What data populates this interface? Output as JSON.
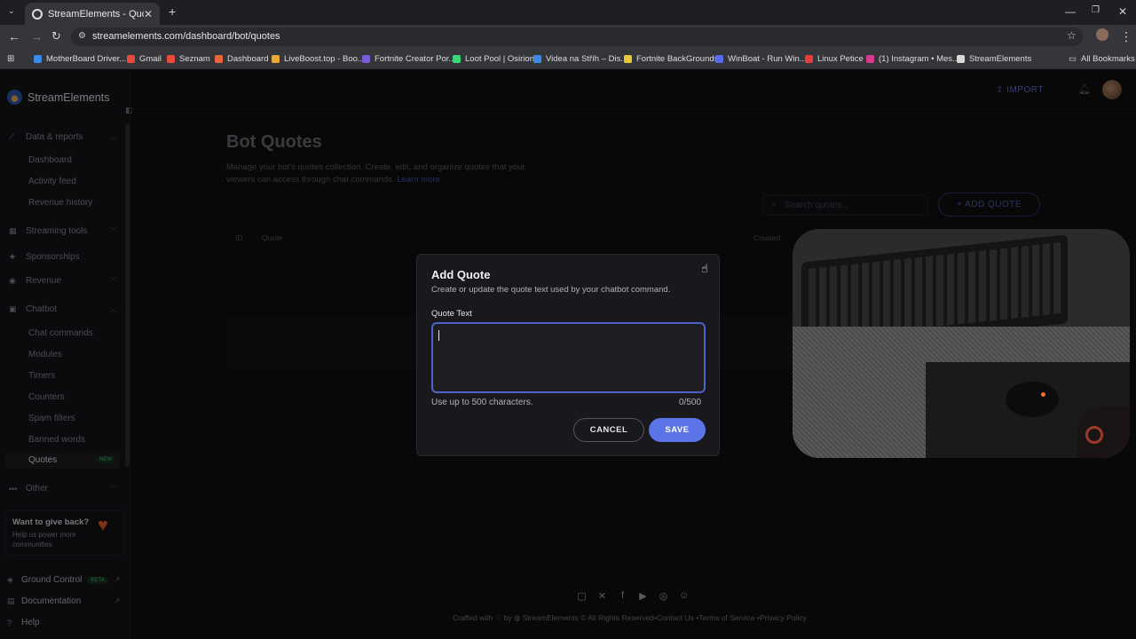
{
  "browser": {
    "tab_title": "StreamElements - Quotes",
    "url": "streamelements.com/dashboard/bot/quotes",
    "new_tab": "+",
    "bookmarks": [
      {
        "label": "MotherBoard Driver...",
        "color": "#3b8be8"
      },
      {
        "label": "Gmail",
        "color": "#e84b3b"
      },
      {
        "label": "Seznam",
        "color": "#e84b3b"
      },
      {
        "label": "Dashboard",
        "color": "#e8653b"
      },
      {
        "label": "LiveBoost.top - Boo...",
        "color": "#e8a83b"
      },
      {
        "label": "Fortnite Creator Por...",
        "color": "#7a5bd8"
      },
      {
        "label": "Loot Pool | Osirion",
        "color": "#3bd87a"
      },
      {
        "label": "Videa na Stříh – Dis...",
        "color": "#3b8be8"
      },
      {
        "label": "Fortnite BackGrounds",
        "color": "#e8c83b"
      },
      {
        "label": "WinBoat - Run Win...",
        "color": "#5b6be8"
      },
      {
        "label": "Linux Petice",
        "color": "#e83b3b"
      },
      {
        "label": "(1) Instagram • Mes...",
        "color": "#d83b8b"
      },
      {
        "label": "StreamElements",
        "color": "#d8d8d8"
      }
    ],
    "all_bookmarks": "All Bookmarks"
  },
  "sidebar": {
    "brand": "StreamElements",
    "sections": {
      "data_reports": "Data & reports",
      "streaming_tools": "Streaming tools",
      "sponsorships": "Sponsorships",
      "revenue": "Revenue",
      "chatbot": "Chatbot",
      "other": "Other"
    },
    "data_items": [
      "Dashboard",
      "Activity feed",
      "Revenue history"
    ],
    "chatbot_items": [
      "Chat commands",
      "Modules",
      "Timers",
      "Counters",
      "Spam filters",
      "Banned words"
    ],
    "active_item": "Quotes",
    "new_badge": "NEW",
    "giveback_title": "Want to give back?",
    "giveback_text": "Help us power more communities",
    "ground_control": "Ground Control",
    "beta_badge": "BETA",
    "documentation": "Documentation",
    "help": "Help"
  },
  "topbar": {
    "import_label": "IMPORT"
  },
  "main": {
    "title": "Bot Quotes",
    "description": "Manage your bot's quotes collection. Create, edit, and organize quotes that your viewers can access through chat commands.",
    "learn_more": "Learn more",
    "search_placeholder": "Search quotes...",
    "add_quote": "ADD QUOTE",
    "columns": {
      "id": "ID",
      "quote": "Quote",
      "created": "Created"
    }
  },
  "footer": {
    "crafted_with": "Crafted with",
    "by": "by",
    "brand": "StreamElements",
    "rights": "© All Rights Reserved",
    "contact": "•Contact Us",
    "terms": "•Terms of Service",
    "privacy": "•Privacy Policy"
  },
  "modal": {
    "title": "Add Quote",
    "subtitle": "Create or update the quote text used by your chatbot command.",
    "field_label": "Quote Text",
    "value": "",
    "helper": "Use up to 500 characters.",
    "counter": "0/500",
    "cancel": "CANCEL",
    "save": "SAVE"
  },
  "colors": {
    "accent": "#5b74e8",
    "focus_border": "#4c63c8",
    "new_badge": "#3bbf6e"
  }
}
